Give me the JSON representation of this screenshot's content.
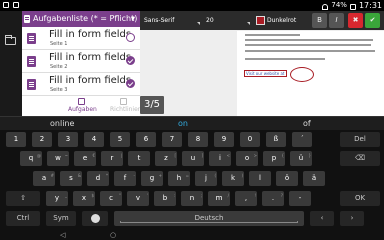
{
  "status": {
    "battery": "74%",
    "time": "17:31"
  },
  "panel": {
    "header": "Aufgabenliste (* = Pflicht)",
    "tasks": [
      {
        "title": "Fill in form fields",
        "sub": "Seite 1",
        "done": false
      },
      {
        "title": "Fill in form fields",
        "sub": "Seite 2",
        "done": true
      },
      {
        "title": "Fill in form fields",
        "sub": "Seite 3",
        "done": true
      }
    ],
    "tabs": [
      "Aufgaben",
      "Richtlinien"
    ]
  },
  "page_indicator": "3/5",
  "toolbar": {
    "font": "Sans-Serif",
    "size": "20",
    "color_label": "Dunkelrot",
    "color": "#a81c24",
    "bold": "B",
    "italic": "I",
    "cancel": "✖",
    "ok": "✔"
  },
  "document": {
    "link": "Visit our website at www.example.com",
    "stamp_text": "www.example.com"
  },
  "suggestions": [
    "online",
    "on",
    "of"
  ],
  "keyboard": {
    "row0": [
      "1",
      "2",
      "3",
      "4",
      "5",
      "6",
      "7",
      "8",
      "9",
      "0",
      "ß",
      "´"
    ],
    "row0_del": "Del",
    "row1": [
      {
        "k": "q",
        "a": "@"
      },
      {
        "k": "w",
        "a": "~"
      },
      {
        "k": "e",
        "a": "€"
      },
      {
        "k": "r",
        "a": "|"
      },
      {
        "k": "t",
        "a": ""
      },
      {
        "k": "z",
        "a": "["
      },
      {
        "k": "u",
        "a": "]"
      },
      {
        "k": "i",
        "a": "<"
      },
      {
        "k": "o",
        "a": ">"
      },
      {
        "k": "p",
        "a": "{"
      },
      {
        "k": "ü",
        "a": "}"
      }
    ],
    "row2": [
      {
        "k": "a",
        "a": "#"
      },
      {
        "k": "s",
        "a": "&"
      },
      {
        "k": "d",
        "a": "*"
      },
      {
        "k": "f",
        "a": "-"
      },
      {
        "k": "g",
        "a": "+"
      },
      {
        "k": "h",
        "a": "="
      },
      {
        "k": "j",
        "a": "("
      },
      {
        "k": "k",
        "a": ")"
      },
      {
        "k": "l",
        "a": ""
      },
      {
        "k": "ö",
        "a": ""
      },
      {
        "k": "ä",
        "a": ""
      }
    ],
    "row3": [
      {
        "k": "y",
        "a": "_"
      },
      {
        "k": "x",
        "a": "$"
      },
      {
        "k": "c",
        "a": "\""
      },
      {
        "k": "v",
        "a": "'"
      },
      {
        "k": "b",
        "a": ":"
      },
      {
        "k": "n",
        "a": ";"
      },
      {
        "k": "m",
        "a": "/"
      },
      {
        "k": ",",
        "a": "!"
      },
      {
        "k": ".",
        "a": "?"
      },
      {
        "k": "-",
        "a": ""
      }
    ],
    "ctrl": "Ctrl",
    "sym": "Sym",
    "space": "Deutsch",
    "ok": "OK",
    "del_icon": "⌫"
  }
}
